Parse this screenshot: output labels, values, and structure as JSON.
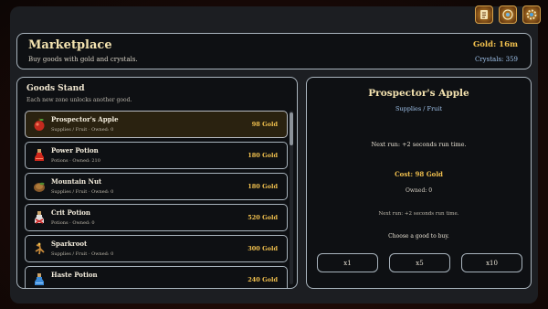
{
  "header": {
    "title": "Marketplace",
    "subtitle": "Buy goods with gold and crystals.",
    "gold": "Gold: 16m",
    "crystals": "Crystals: 359"
  },
  "top_icons": [
    "scroll-icon",
    "compass-icon",
    "gear-icon"
  ],
  "goods_stand": {
    "title": "Goods Stand",
    "subtitle": "Each new zone unlocks another good.",
    "items": [
      {
        "name": "Prospector's Apple",
        "meta": "Supplies / Fruit · Owned: 0",
        "price": "98 Gold",
        "icon": "apple-icon",
        "selected": true
      },
      {
        "name": "Power Potion",
        "meta": "Potions · Owned: 210",
        "price": "180 Gold",
        "icon": "red-potion-icon",
        "selected": false
      },
      {
        "name": "Mountain Nut",
        "meta": "Supplies / Fruit · Owned: 0",
        "price": "180 Gold",
        "icon": "nut-icon",
        "selected": false
      },
      {
        "name": "Crit Potion",
        "meta": "Potions · Owned: 0",
        "price": "520 Gold",
        "icon": "crit-potion-icon",
        "selected": false
      },
      {
        "name": "Sparkroot",
        "meta": "Supplies / Fruit · Owned: 0",
        "price": "300 Gold",
        "icon": "root-icon",
        "selected": false
      },
      {
        "name": "Haste Potion",
        "meta": "",
        "price": "240 Gold",
        "icon": "blue-potion-icon",
        "selected": false
      }
    ]
  },
  "detail": {
    "name": "Prospector's Apple",
    "category": "Supplies / Fruit",
    "effect": "Next run: +2 seconds run time.",
    "cost": "Cost: 98 Gold",
    "owned": "Owned: 0",
    "next_run": "Next run: +2 seconds run time.",
    "hint": "Choose a good to buy.",
    "buttons": [
      "x1",
      "x5",
      "x10"
    ]
  },
  "colors": {
    "gold": "#f2c14e",
    "crystal": "#9fc2ea",
    "panel": "#0e1013",
    "border": "#a9b4bd"
  }
}
